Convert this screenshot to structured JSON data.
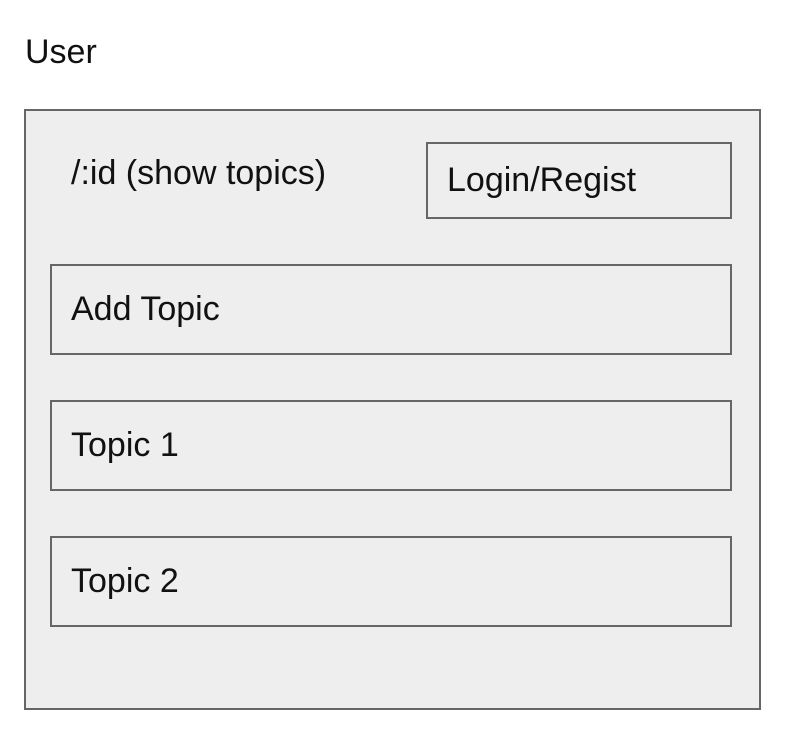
{
  "page": {
    "title": "User"
  },
  "panel": {
    "route_label": "/:id (show topics)",
    "login_label": "Login/Regist",
    "add_topic_label": "Add Topic",
    "topics": [
      {
        "label": "Topic 1"
      },
      {
        "label": "Topic 2"
      }
    ]
  },
  "colors": {
    "panel_background": "#eeeeee",
    "border": "#666666",
    "text": "#111111"
  }
}
